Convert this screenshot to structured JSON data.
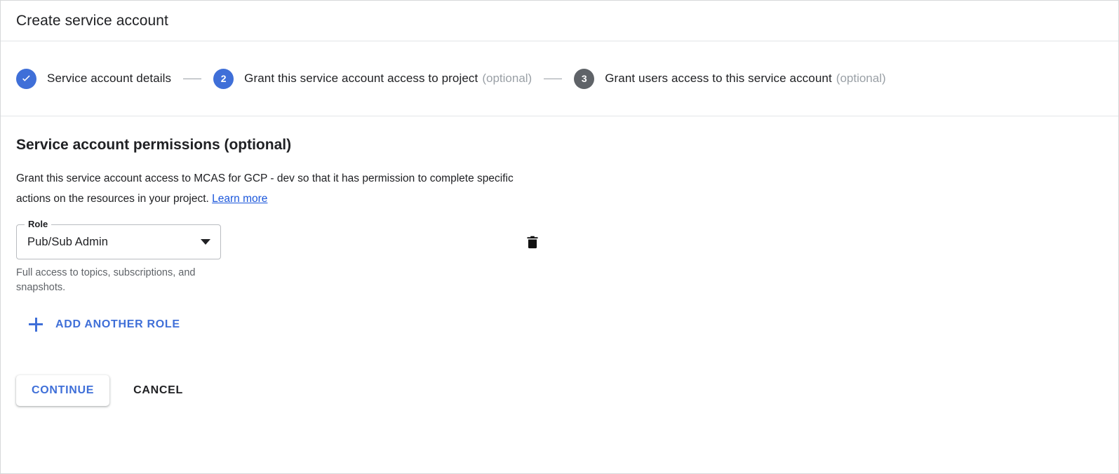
{
  "window": {
    "title": "Create service account"
  },
  "stepper": {
    "steps": [
      {
        "id": "service-account-details",
        "badge": "check",
        "state": "done",
        "label": "Service account details",
        "optional": ""
      },
      {
        "id": "grant-access-to-project",
        "badge": "2",
        "state": "active",
        "label": "Grant this service account access to project",
        "optional": "(optional)"
      },
      {
        "id": "grant-users-access",
        "badge": "3",
        "state": "pending",
        "label": "Grant users access to this service account",
        "optional": "(optional)"
      }
    ],
    "connector": "—"
  },
  "main": {
    "heading": "Service account permissions (optional)",
    "description": "Grant this service account access to MCAS for GCP - dev so that it has permission to complete specific actions on the resources in your project.",
    "learn_more": "Learn more",
    "role": {
      "label": "Role",
      "value": "Pub/Sub Admin",
      "helper_text": "Full access to topics, subscriptions, and snapshots.",
      "delete_icon": "trash-icon",
      "dropdown_icon": "chevron-down-icon"
    },
    "add_another_role": {
      "label": "ADD ANOTHER ROLE",
      "icon": "plus-icon"
    }
  },
  "actions": {
    "continue_label": "CONTINUE",
    "cancel_label": "CANCEL"
  },
  "colors": {
    "accent_blue": "#3f6fd8",
    "link_blue": "#1a56db",
    "pending_gray": "#5f6368",
    "text_primary": "#202124",
    "text_secondary": "#5f6368",
    "border": "#d6d8da"
  }
}
